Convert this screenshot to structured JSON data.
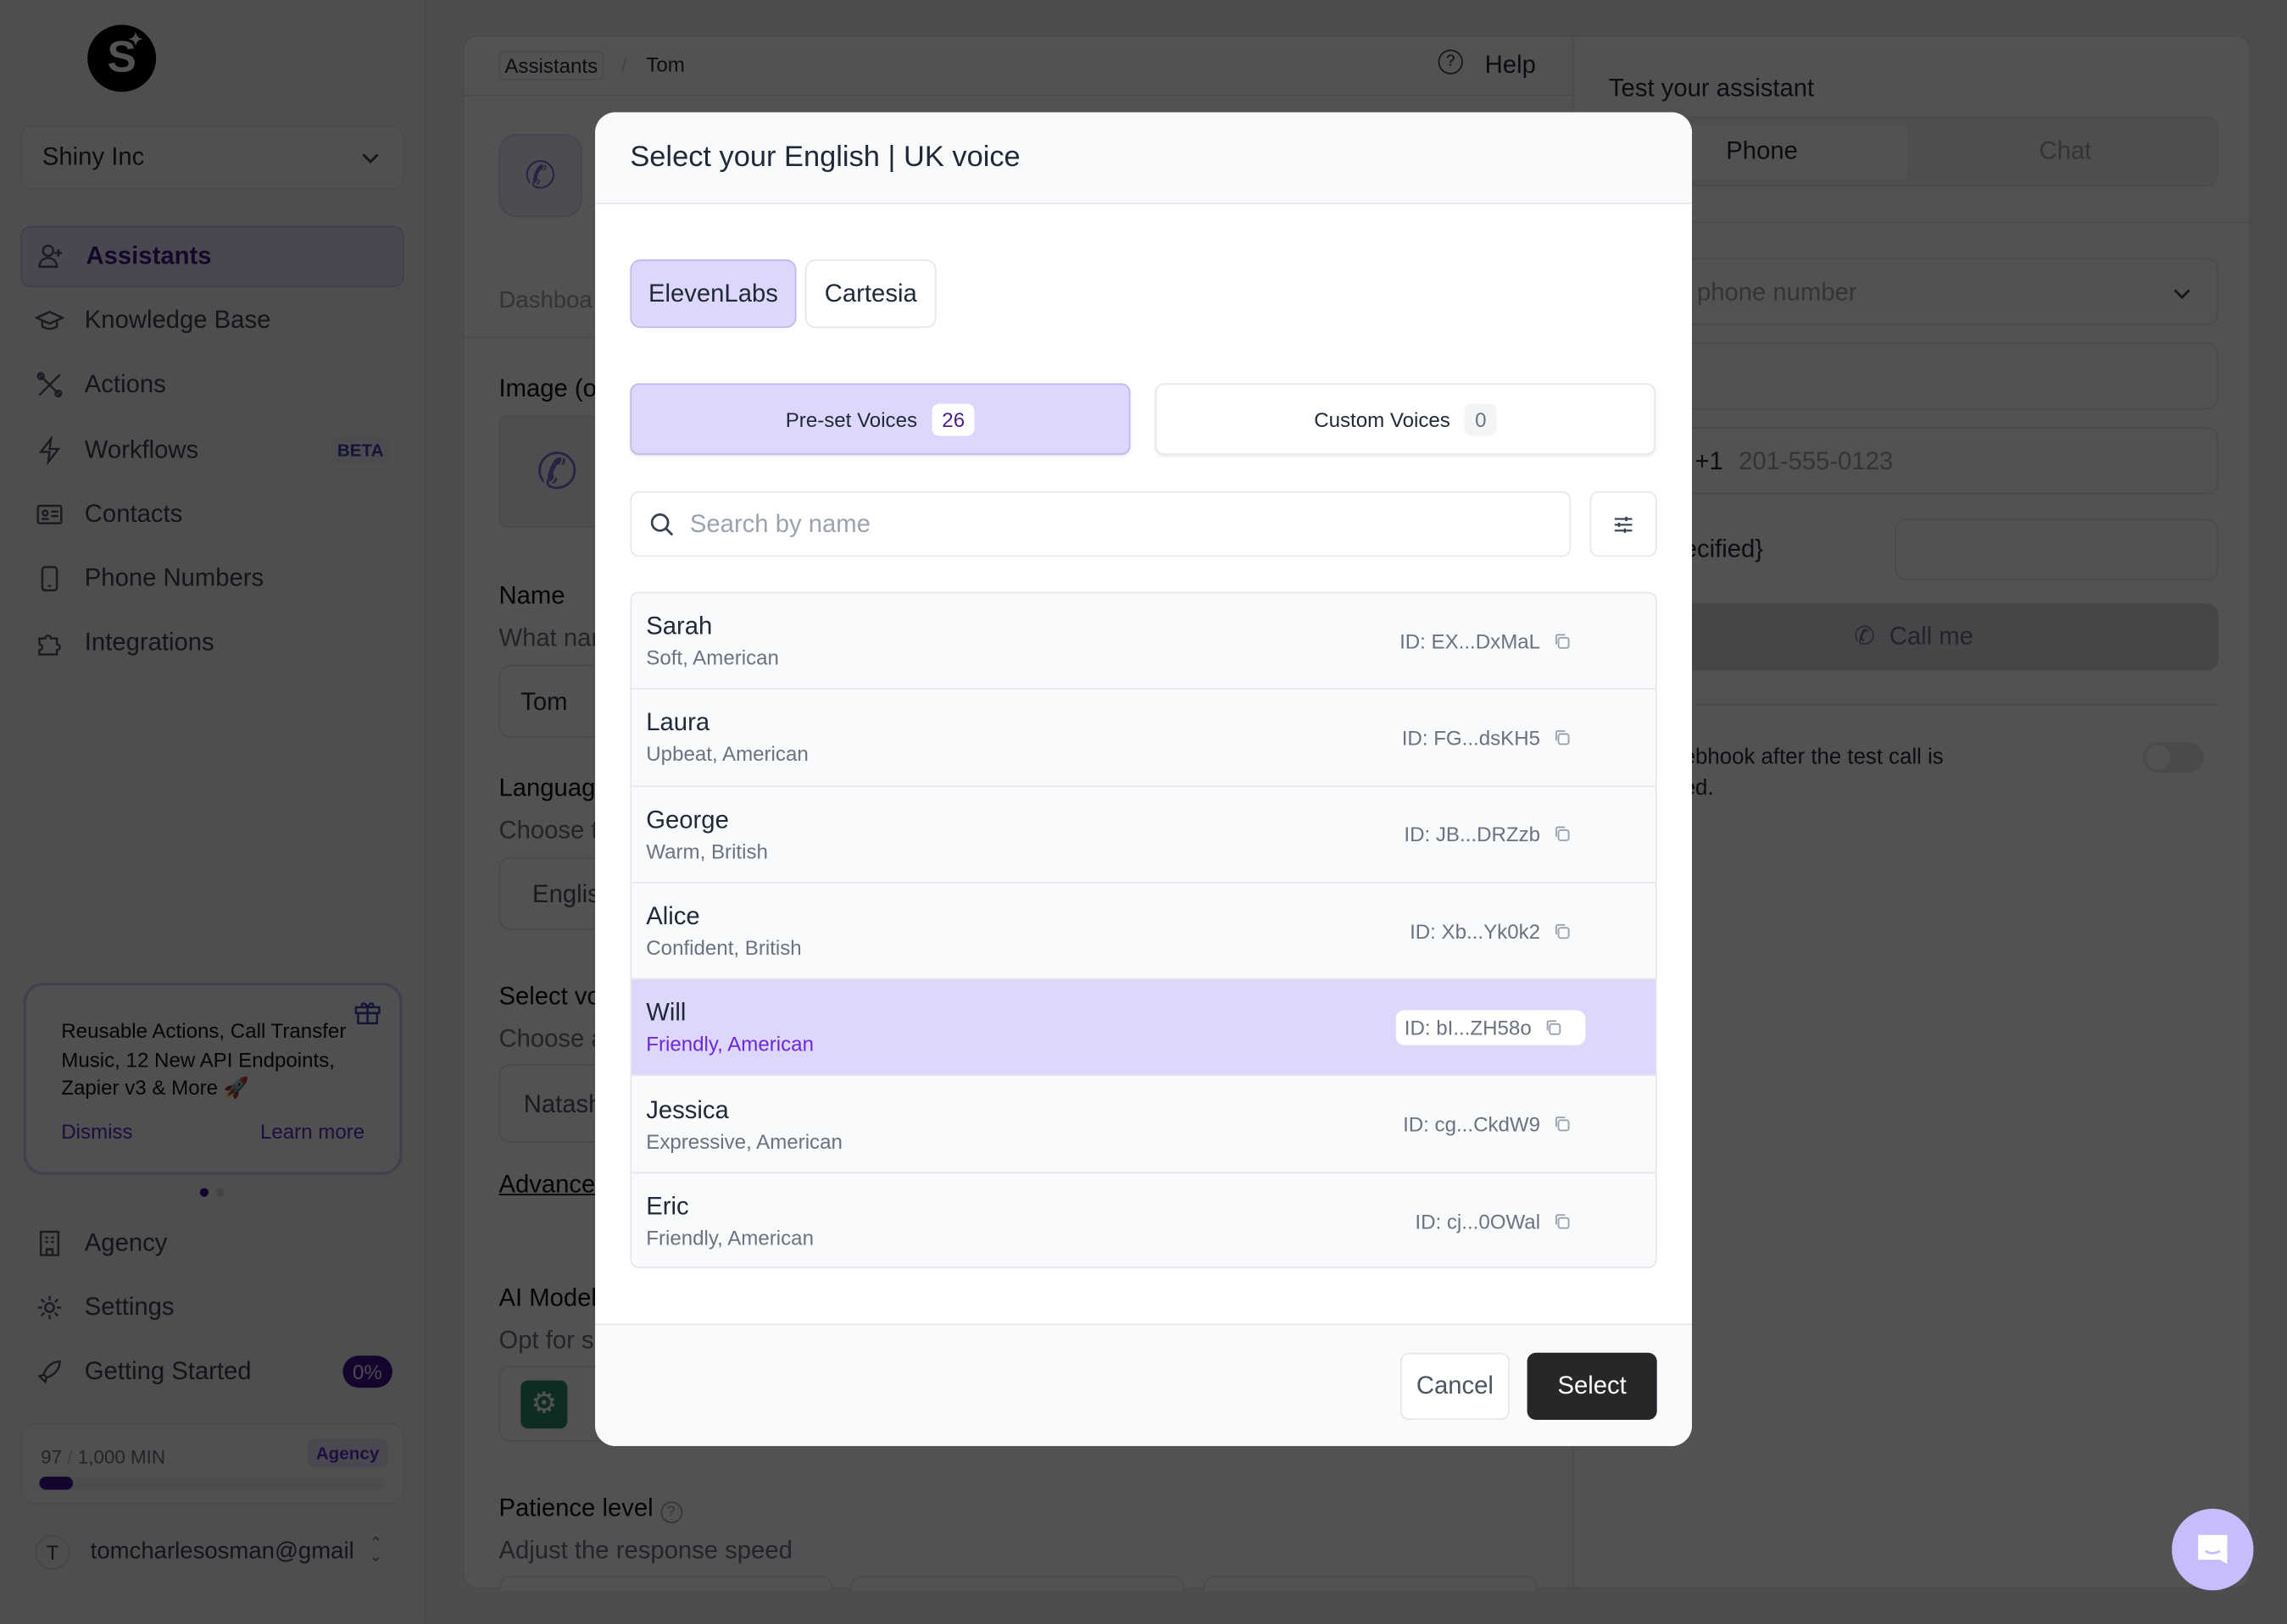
{
  "sidebar": {
    "logo_letter": "S",
    "org": "Shiny Inc",
    "nav": [
      {
        "label": "Assistants",
        "icon": "user-plus-icon",
        "active": true
      },
      {
        "label": "Knowledge Base",
        "icon": "graduation-cap-icon"
      },
      {
        "label": "Actions",
        "icon": "tools-icon"
      },
      {
        "label": "Workflows",
        "icon": "lightning-icon",
        "badge": "BETA"
      },
      {
        "label": "Contacts",
        "icon": "contact-card-icon"
      },
      {
        "label": "Phone Numbers",
        "icon": "smartphone-icon"
      },
      {
        "label": "Integrations",
        "icon": "puzzle-icon"
      }
    ],
    "announcement": {
      "text": "Reusable Actions, Call Transfer Music, 12 New API Endpoints, Zapier v3 & More 🚀",
      "dismiss": "Dismiss",
      "learn_more": "Learn more"
    },
    "bottom_nav": [
      {
        "label": "Agency",
        "icon": "building-icon"
      },
      {
        "label": "Settings",
        "icon": "gear-icon"
      },
      {
        "label": "Getting Started",
        "icon": "rocket-icon",
        "badge": "0%"
      }
    ],
    "usage": {
      "used": "97",
      "sep": "/",
      "total": "1,000 MIN",
      "plan": "Agency",
      "progress_fraction": 0.097
    },
    "user": {
      "initial": "T",
      "email": "tomcharlesosman@gmail"
    }
  },
  "main": {
    "breadcrumb": [
      "Assistants",
      "Tom"
    ],
    "help": "Help",
    "tab_partial": "Dashboa",
    "image_label": "Image (o",
    "name_label": "Name",
    "name_sub": "What nar",
    "name_value": "Tom",
    "language_label": "Languag",
    "language_sub": "Choose t",
    "language_value": "Englis",
    "voice_label": "Select vo",
    "voice_sub": "Choose a",
    "voice_value": "Natash",
    "advanced": "Advance",
    "ai_model_label": "AI Model",
    "ai_model_sub": "Opt for s",
    "patience_label": "Patience level",
    "patience_sub": "Adjust the response speed"
  },
  "test_panel": {
    "title": "Test your assistant",
    "tabs": [
      "Phone",
      "Chat"
    ],
    "phone_select_placeholder": "t phone number",
    "country_code": "+1",
    "phone_placeholder": "201-555-0123",
    "specified_text": "ecified}",
    "call_button": "Call me",
    "webhook_text_1": "ebhook after the test call is",
    "webhook_text_2": "ed.",
    "webhook_toggle_on": false
  },
  "modal": {
    "title": "Select your English | UK voice",
    "providers": [
      {
        "label": "ElevenLabs",
        "selected": true
      },
      {
        "label": "Cartesia",
        "selected": false
      }
    ],
    "tabs": [
      {
        "label": "Pre-set Voices",
        "count": "26",
        "selected": true
      },
      {
        "label": "Custom Voices",
        "count": "0",
        "selected": false
      }
    ],
    "search_placeholder": "Search by name",
    "voices": [
      {
        "name": "Sarah",
        "desc": "Soft, American",
        "id": "ID: EX...DxMaL"
      },
      {
        "name": "Laura",
        "desc": "Upbeat, American",
        "id": "ID: FG...dsKH5"
      },
      {
        "name": "George",
        "desc": "Warm, British",
        "id": "ID: JB...DRZzb"
      },
      {
        "name": "Alice",
        "desc": "Confident, British",
        "id": "ID: Xb...Yk0k2"
      },
      {
        "name": "Will",
        "desc": "Friendly, American",
        "id": "ID: bI...ZH58o",
        "selected": true
      },
      {
        "name": "Jessica",
        "desc": "Expressive, American",
        "id": "ID: cg...CkdW9"
      },
      {
        "name": "Eric",
        "desc": "Friendly, American",
        "id": "ID: cj...0OWal"
      }
    ],
    "cancel": "Cancel",
    "select": "Select"
  },
  "colors": {
    "accent": "#5b2bc6",
    "selected_bg": "#ddd8fb",
    "primary_button": "#27272a"
  }
}
